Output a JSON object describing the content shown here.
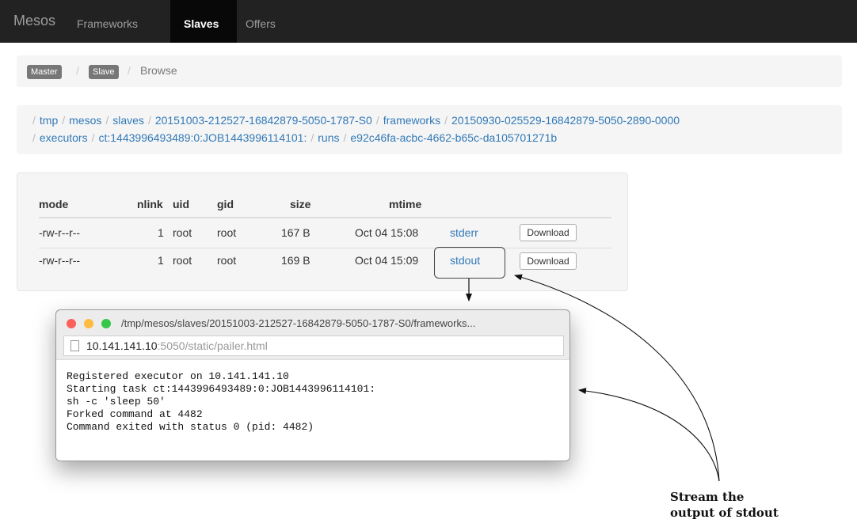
{
  "navbar": {
    "brand": "Mesos",
    "items": [
      {
        "label": "Frameworks",
        "active": false
      },
      {
        "label": "Slaves",
        "active": true
      },
      {
        "label": "Offers",
        "active": false
      }
    ]
  },
  "breadcrumb": {
    "items": [
      "Master",
      "Slave"
    ],
    "current": "Browse",
    "separator": "/"
  },
  "path": {
    "line1": [
      "tmp",
      "mesos",
      "slaves",
      "20151003-212527-16842879-5050-1787-S0",
      "frameworks",
      "20150930-025529-16842879-5050-2890-0000"
    ],
    "line2": [
      "executors",
      "ct:1443996493489:0:JOB1443996114101:",
      "runs",
      "e92c46fa-acbc-4662-b65c-da105701271b"
    ]
  },
  "files": {
    "columns": [
      "mode",
      "nlink",
      "uid",
      "gid",
      "size",
      "mtime"
    ],
    "rows": [
      {
        "mode": "-rw-r--r--",
        "nlink": "1",
        "uid": "root",
        "gid": "root",
        "size": "167 B",
        "mtime": "Oct 04 15:08",
        "name": "stderr",
        "action": "Download"
      },
      {
        "mode": "-rw-r--r--",
        "nlink": "1",
        "uid": "root",
        "gid": "root",
        "size": "169 B",
        "mtime": "Oct 04 15:09",
        "name": "stdout",
        "action": "Download"
      }
    ]
  },
  "window": {
    "title": "/tmp/mesos/slaves/20151003-212527-16842879-5050-1787-S0/frameworks...",
    "url_host": "10.141.141.10",
    "url_rest": ":5050/static/pailer.html",
    "traffic_colors": [
      "#fc605b",
      "#fdbc40",
      "#34c84a"
    ],
    "log": [
      "Registered executor on 10.141.141.10",
      "Starting task ct:1443996493489:0:JOB1443996114101:",
      "sh -c 'sleep 50'",
      "Forked command at 4482",
      "Command exited with status 0 (pid: 4482)"
    ]
  },
  "annotation": {
    "line1": "Stream the",
    "line2": "output of stdout"
  },
  "colors": {
    "navbar": "#222222",
    "link": "#337ab7",
    "panel": "#f5f5f5"
  }
}
